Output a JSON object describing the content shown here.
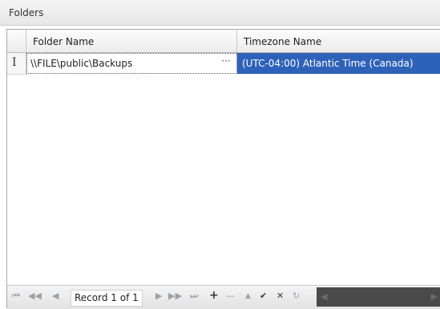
{
  "panel": {
    "title": "Folders"
  },
  "grid": {
    "columns": [
      {
        "label": "Folder Name"
      },
      {
        "label": "Timezone Name"
      }
    ],
    "rows": [
      {
        "indicator": "I",
        "folder_name": "\\\\FILE\\public\\Backups",
        "edit_button": "···",
        "timezone_name": "(UTC-04:00) Atlantic Time (Canada)"
      }
    ]
  },
  "navigator": {
    "record_text": "Record 1 of 1",
    "buttons": {
      "first": "⏮",
      "prev_page": "◀◀",
      "prev": "◀",
      "next": "▶",
      "next_page": "▶▶",
      "last": "⏭",
      "append": "+",
      "delete": "—",
      "edit": "▲",
      "end_edit": "✔",
      "cancel": "✕",
      "refresh": "↻"
    },
    "scroll_left": "◀",
    "scroll_right": "▶"
  }
}
